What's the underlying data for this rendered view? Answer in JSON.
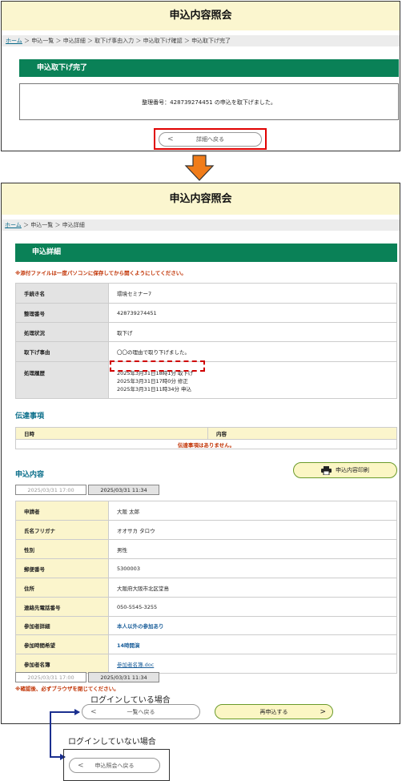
{
  "screen1": {
    "title": "申込内容照会",
    "breadcrumb": [
      "ホーム",
      "申込一覧",
      "申込詳細",
      "取下げ事由入力",
      "申込取下げ確認",
      "申込取下げ完了"
    ],
    "section_title": "申込取下げ完了",
    "message": "整理番号：428739274451 の申込を取下げました。",
    "back_button": "詳細へ戻る"
  },
  "screen2": {
    "title": "申込内容照会",
    "breadcrumb": [
      "ホーム",
      "申込一覧",
      "申込詳細"
    ],
    "section_title": "申込詳細",
    "notice": "※添付ファイルは一度パソコンに保存してから開くようにしてください。",
    "details": [
      {
        "label": "手続き名",
        "value": "環境セミナー7"
      },
      {
        "label": "整理番号",
        "value": "428739274451"
      },
      {
        "label": "処理状況",
        "value": "取下げ"
      },
      {
        "label": "取下げ事由",
        "value": "〇〇の理由で取り下げました。"
      }
    ],
    "history_label": "処理履歴",
    "history": [
      "2025年3月31日18時1分 取下げ",
      "2025年3月31日17時0分 修正",
      "2025年3月31日11時34分 申込"
    ],
    "messages_title": "伝達事項",
    "messages_cols": [
      "日時",
      "内容"
    ],
    "messages_empty": "伝達事項はありません。",
    "content_title": "申込内容",
    "print_button": "申込内容印刷",
    "version_tabs": [
      "2025/03/31 17:00",
      "2025/03/31 11:34"
    ],
    "content": [
      {
        "label": "申請者",
        "value": "大阪 太郎"
      },
      {
        "label": "氏名フリガナ",
        "value": "オオサカ タロウ"
      },
      {
        "label": "性別",
        "value": "男性"
      },
      {
        "label": "郵便番号",
        "value": "5300003"
      },
      {
        "label": "住所",
        "value": "大阪府大阪市北区堂島"
      },
      {
        "label": "連絡先電話番号",
        "value": "050-5545-3255"
      },
      {
        "label": "参加者詳細",
        "value": "本人以外の参加あり"
      },
      {
        "label": "参加時間希望",
        "value": "14時開演"
      },
      {
        "label": "参加者名簿",
        "value": "参加者名簿.doc"
      }
    ],
    "close_notice": "※確認後、必ずブラウザを閉じてください。",
    "list_back_button": "一覧へ戻る",
    "reapply_button": "再申込する"
  },
  "captions": {
    "logged_in": "ログインしている場合",
    "logged_out": "ログインしていない場合"
  },
  "logged_out_button": "申込照会へ戻る",
  "colors": {
    "green": "#0a8157",
    "header_bg": "#fbf6cf",
    "highlight_red": "#e00000"
  }
}
